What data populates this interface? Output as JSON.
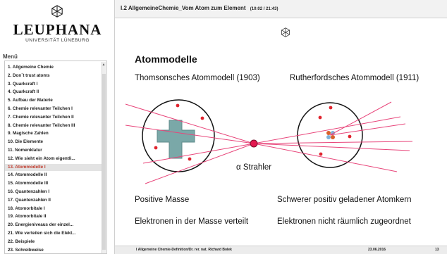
{
  "sidebar": {
    "brand": "LEUPHANA",
    "brand_sub": "UNIVERSITÄT LÜNEBURG",
    "menu_title": "Menü",
    "items": [
      {
        "label": "1. Allgemeine Chemie"
      },
      {
        "label": "2. Don´t trust atoms"
      },
      {
        "label": "3. Quarkcraft I"
      },
      {
        "label": "4. Quarkcraft II"
      },
      {
        "label": "5. Aufbau der Materie"
      },
      {
        "label": "6. Chemie relevanter Teilchen I"
      },
      {
        "label": "7. Chemie relevanter Teilchen II"
      },
      {
        "label": "8. Chemie relevanter Teilchen III"
      },
      {
        "label": "9. Magische Zahlen"
      },
      {
        "label": "10. Die Elemente"
      },
      {
        "label": "11. Nomenklatur"
      },
      {
        "label": "12. Wie sieht ein Atom eigentli..."
      },
      {
        "label": "13. Atommodelle I",
        "active": true
      },
      {
        "label": "14. Atommodelle II"
      },
      {
        "label": "15. Atommodelle III"
      },
      {
        "label": "16. Quantenzahlen I"
      },
      {
        "label": "17. Quantenzahlen II"
      },
      {
        "label": "18. Atomorbitale I"
      },
      {
        "label": "19. Atomorbitale II"
      },
      {
        "label": "20. Energieniveaus der einzel..."
      },
      {
        "label": "21. Wie verteilen sich die Elekt..."
      },
      {
        "label": "22. Beispiele"
      },
      {
        "label": "23. Schreibweise"
      }
    ]
  },
  "header": {
    "title": "I.2 AllgemeineChemie_Vom Atom zum Element",
    "time": "(10:02 / 21:43)"
  },
  "slide": {
    "heading": "Atommodelle",
    "thomson_title": "Thomsonsches Atommodell (1903)",
    "rutherford_title": "Rutherfordsches Atommodell (1911)",
    "alpha_label": "α Strahler",
    "thomson_mass": "Positive Masse",
    "rutherford_mass": "Schwerer positiv geladener Atomkern",
    "thomson_electrons": "Elektronen in der Masse verteilt",
    "rutherford_electrons": "Elektronen nicht räumlich zugeordnet",
    "colors": {
      "ray": "#e8457a",
      "source": "#e2184f",
      "electron": "#e0242e",
      "positive_mass": "#7aa8a8",
      "nucleus_orange": "#d9602a",
      "nucleus_blue": "#7fb0d8"
    }
  },
  "footer": {
    "left": "I Allgemeine Chemie-Definition/Dr. rer. nat. Richard Bolek",
    "date": "23.06.2016",
    "page": "13"
  }
}
